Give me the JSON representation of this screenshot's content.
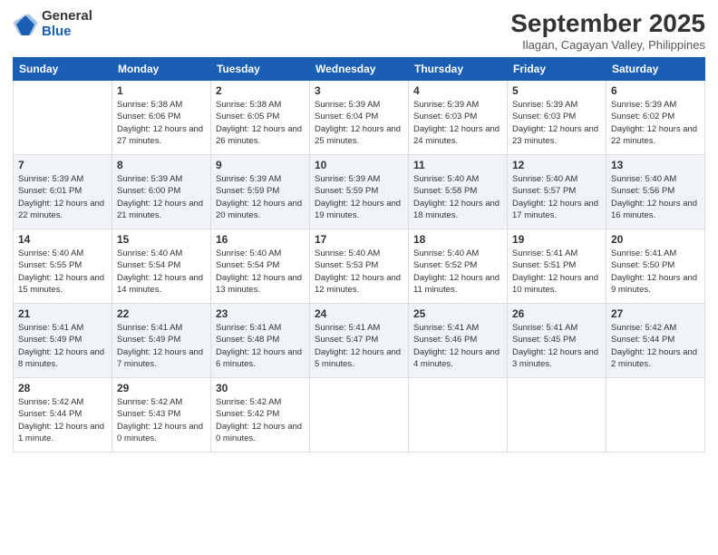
{
  "logo": {
    "general": "General",
    "blue": "Blue"
  },
  "header": {
    "month": "September 2025",
    "location": "Ilagan, Cagayan Valley, Philippines"
  },
  "weekdays": [
    "Sunday",
    "Monday",
    "Tuesday",
    "Wednesday",
    "Thursday",
    "Friday",
    "Saturday"
  ],
  "weeks": [
    [
      {
        "day": "",
        "sunrise": "",
        "sunset": "",
        "daylight": ""
      },
      {
        "day": "1",
        "sunrise": "Sunrise: 5:38 AM",
        "sunset": "Sunset: 6:06 PM",
        "daylight": "Daylight: 12 hours and 27 minutes."
      },
      {
        "day": "2",
        "sunrise": "Sunrise: 5:38 AM",
        "sunset": "Sunset: 6:05 PM",
        "daylight": "Daylight: 12 hours and 26 minutes."
      },
      {
        "day": "3",
        "sunrise": "Sunrise: 5:39 AM",
        "sunset": "Sunset: 6:04 PM",
        "daylight": "Daylight: 12 hours and 25 minutes."
      },
      {
        "day": "4",
        "sunrise": "Sunrise: 5:39 AM",
        "sunset": "Sunset: 6:03 PM",
        "daylight": "Daylight: 12 hours and 24 minutes."
      },
      {
        "day": "5",
        "sunrise": "Sunrise: 5:39 AM",
        "sunset": "Sunset: 6:03 PM",
        "daylight": "Daylight: 12 hours and 23 minutes."
      },
      {
        "day": "6",
        "sunrise": "Sunrise: 5:39 AM",
        "sunset": "Sunset: 6:02 PM",
        "daylight": "Daylight: 12 hours and 22 minutes."
      }
    ],
    [
      {
        "day": "7",
        "sunrise": "Sunrise: 5:39 AM",
        "sunset": "Sunset: 6:01 PM",
        "daylight": "Daylight: 12 hours and 22 minutes."
      },
      {
        "day": "8",
        "sunrise": "Sunrise: 5:39 AM",
        "sunset": "Sunset: 6:00 PM",
        "daylight": "Daylight: 12 hours and 21 minutes."
      },
      {
        "day": "9",
        "sunrise": "Sunrise: 5:39 AM",
        "sunset": "Sunset: 5:59 PM",
        "daylight": "Daylight: 12 hours and 20 minutes."
      },
      {
        "day": "10",
        "sunrise": "Sunrise: 5:39 AM",
        "sunset": "Sunset: 5:59 PM",
        "daylight": "Daylight: 12 hours and 19 minutes."
      },
      {
        "day": "11",
        "sunrise": "Sunrise: 5:40 AM",
        "sunset": "Sunset: 5:58 PM",
        "daylight": "Daylight: 12 hours and 18 minutes."
      },
      {
        "day": "12",
        "sunrise": "Sunrise: 5:40 AM",
        "sunset": "Sunset: 5:57 PM",
        "daylight": "Daylight: 12 hours and 17 minutes."
      },
      {
        "day": "13",
        "sunrise": "Sunrise: 5:40 AM",
        "sunset": "Sunset: 5:56 PM",
        "daylight": "Daylight: 12 hours and 16 minutes."
      }
    ],
    [
      {
        "day": "14",
        "sunrise": "Sunrise: 5:40 AM",
        "sunset": "Sunset: 5:55 PM",
        "daylight": "Daylight: 12 hours and 15 minutes."
      },
      {
        "day": "15",
        "sunrise": "Sunrise: 5:40 AM",
        "sunset": "Sunset: 5:54 PM",
        "daylight": "Daylight: 12 hours and 14 minutes."
      },
      {
        "day": "16",
        "sunrise": "Sunrise: 5:40 AM",
        "sunset": "Sunset: 5:54 PM",
        "daylight": "Daylight: 12 hours and 13 minutes."
      },
      {
        "day": "17",
        "sunrise": "Sunrise: 5:40 AM",
        "sunset": "Sunset: 5:53 PM",
        "daylight": "Daylight: 12 hours and 12 minutes."
      },
      {
        "day": "18",
        "sunrise": "Sunrise: 5:40 AM",
        "sunset": "Sunset: 5:52 PM",
        "daylight": "Daylight: 12 hours and 11 minutes."
      },
      {
        "day": "19",
        "sunrise": "Sunrise: 5:41 AM",
        "sunset": "Sunset: 5:51 PM",
        "daylight": "Daylight: 12 hours and 10 minutes."
      },
      {
        "day": "20",
        "sunrise": "Sunrise: 5:41 AM",
        "sunset": "Sunset: 5:50 PM",
        "daylight": "Daylight: 12 hours and 9 minutes."
      }
    ],
    [
      {
        "day": "21",
        "sunrise": "Sunrise: 5:41 AM",
        "sunset": "Sunset: 5:49 PM",
        "daylight": "Daylight: 12 hours and 8 minutes."
      },
      {
        "day": "22",
        "sunrise": "Sunrise: 5:41 AM",
        "sunset": "Sunset: 5:49 PM",
        "daylight": "Daylight: 12 hours and 7 minutes."
      },
      {
        "day": "23",
        "sunrise": "Sunrise: 5:41 AM",
        "sunset": "Sunset: 5:48 PM",
        "daylight": "Daylight: 12 hours and 6 minutes."
      },
      {
        "day": "24",
        "sunrise": "Sunrise: 5:41 AM",
        "sunset": "Sunset: 5:47 PM",
        "daylight": "Daylight: 12 hours and 5 minutes."
      },
      {
        "day": "25",
        "sunrise": "Sunrise: 5:41 AM",
        "sunset": "Sunset: 5:46 PM",
        "daylight": "Daylight: 12 hours and 4 minutes."
      },
      {
        "day": "26",
        "sunrise": "Sunrise: 5:41 AM",
        "sunset": "Sunset: 5:45 PM",
        "daylight": "Daylight: 12 hours and 3 minutes."
      },
      {
        "day": "27",
        "sunrise": "Sunrise: 5:42 AM",
        "sunset": "Sunset: 5:44 PM",
        "daylight": "Daylight: 12 hours and 2 minutes."
      }
    ],
    [
      {
        "day": "28",
        "sunrise": "Sunrise: 5:42 AM",
        "sunset": "Sunset: 5:44 PM",
        "daylight": "Daylight: 12 hours and 1 minute."
      },
      {
        "day": "29",
        "sunrise": "Sunrise: 5:42 AM",
        "sunset": "Sunset: 5:43 PM",
        "daylight": "Daylight: 12 hours and 0 minutes."
      },
      {
        "day": "30",
        "sunrise": "Sunrise: 5:42 AM",
        "sunset": "Sunset: 5:42 PM",
        "daylight": "Daylight: 12 hours and 0 minutes."
      },
      {
        "day": "",
        "sunrise": "",
        "sunset": "",
        "daylight": ""
      },
      {
        "day": "",
        "sunrise": "",
        "sunset": "",
        "daylight": ""
      },
      {
        "day": "",
        "sunrise": "",
        "sunset": "",
        "daylight": ""
      },
      {
        "day": "",
        "sunrise": "",
        "sunset": "",
        "daylight": ""
      }
    ]
  ]
}
